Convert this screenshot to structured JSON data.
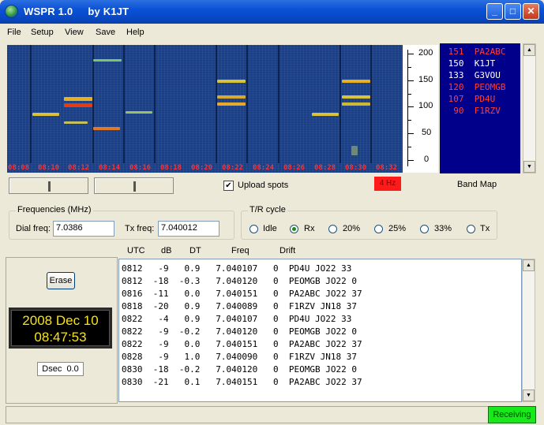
{
  "window": {
    "title": "WSPR 1.0     by K1JT",
    "minimize": "_",
    "maximize": "□",
    "close": "✕"
  },
  "menu": {
    "file": "File",
    "setup": "Setup",
    "view": "View",
    "save": "Save",
    "help": "Help"
  },
  "waterfall": {
    "times": [
      "08:08",
      "08:10",
      "08:12",
      "08:14",
      "08:16",
      "08:18",
      "08:20",
      "08:22",
      "08:24",
      "08:26",
      "08:28",
      "08:30",
      "08:32"
    ],
    "scale": {
      "t200": "200",
      "t150": "150",
      "t100": "100",
      "t50": "50",
      "t0": "0"
    }
  },
  "band_map": {
    "rows": [
      {
        "text": " 151  PA2ABC",
        "color": "#ff3b3b"
      },
      {
        "text": " 150  K1JT",
        "color": "#ffffff"
      },
      {
        "text": " 133  G3VOU",
        "color": "#ffffff"
      },
      {
        "text": " 120  PEOMGB",
        "color": "#ff3b3b"
      },
      {
        "text": " 107  PD4U",
        "color": "#ff3b3b"
      },
      {
        "text": "  90  F1RZV",
        "color": "#ff3b3b"
      }
    ],
    "label": "Band Map"
  },
  "controls": {
    "upload_label": "Upload spots",
    "upload_checked": true,
    "hz_badge": "4 Hz"
  },
  "frequencies": {
    "title": "Frequencies (MHz)",
    "dial_label": "Dial freq:",
    "dial_value": "7.0386",
    "tx_label": "Tx freq:",
    "tx_value": "7.040012"
  },
  "tr_cycle": {
    "title": "T/R cycle",
    "options": [
      "Idle",
      "Rx",
      "20%",
      "25%",
      "33%",
      "Tx"
    ],
    "selected": "Rx"
  },
  "left": {
    "erase": "Erase",
    "date": "2008 Dec 10",
    "time": "08:47:53",
    "dsec": "Dsec  0.0"
  },
  "decodes": {
    "headers": {
      "utc": "UTC",
      "db": "dB",
      "dt": "DT",
      "freq": "Freq",
      "drift": "Drift"
    },
    "rows": [
      "0812   -9   0.9   7.040107   0  PD4U JO22 33",
      "0812  -18  -0.3   7.040120   0  PEOMGB JO22 0",
      "0816  -11   0.0   7.040151   0  PA2ABC JO22 37",
      "0818  -20   0.9   7.040089   0  F1RZV JN18 37",
      "0822   -4   0.9   7.040107   0  PD4U JO22 33",
      "0822   -9  -0.2   7.040120   0  PEOMGB JO22 0",
      "0822   -9   0.0   7.040151   0  PA2ABC JO22 37",
      "0828   -9   1.0   7.040090   0  F1RZV JN18 37",
      "0830  -18  -0.2   7.040120   0  PEOMGB JO22 0",
      "0830  -21   0.1   7.040151   0  PA2ABC JO22 37"
    ]
  },
  "status": {
    "state": "Receiving"
  }
}
